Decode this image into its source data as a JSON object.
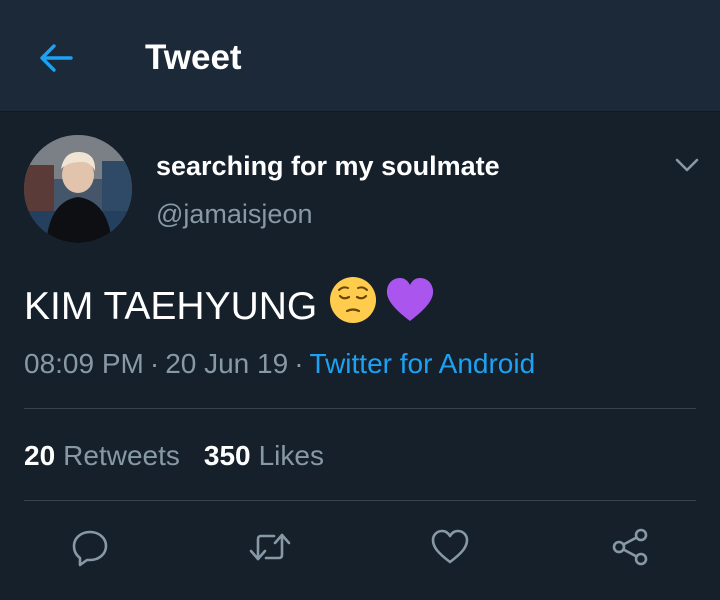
{
  "header": {
    "title": "Tweet",
    "back_icon": "arrow-left-icon",
    "accent_color": "#1da1f2"
  },
  "author": {
    "display_name": "searching for my soulmate",
    "handle": "@jamaisjeon",
    "menu_icon": "chevron-down-icon"
  },
  "tweet": {
    "text": "KIM TAEHYUNG",
    "emojis": [
      "pensive-face-emoji",
      "purple-heart-emoji"
    ],
    "time": "08:09 PM",
    "date": "20 Jun 19",
    "separator": "·",
    "source": "Twitter for Android"
  },
  "stats": {
    "retweets_count": "20",
    "retweets_label": "Retweets",
    "likes_count": "350",
    "likes_label": "Likes"
  },
  "actions": [
    {
      "icon": "reply-icon"
    },
    {
      "icon": "retweet-icon"
    },
    {
      "icon": "like-heart-icon"
    },
    {
      "icon": "share-icon"
    }
  ],
  "colors": {
    "background": "#15202b",
    "header_background": "#1c2938",
    "secondary_text": "#8899a6",
    "link": "#1da1f2",
    "divider": "#38444d"
  }
}
